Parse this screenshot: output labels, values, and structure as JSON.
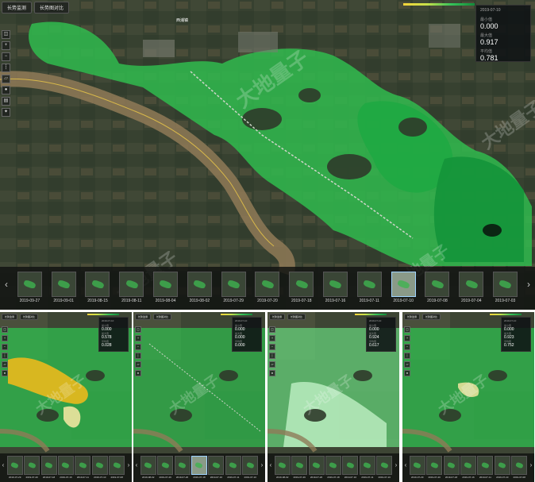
{
  "tabs": [
    "长势监测",
    "长势图对比"
  ],
  "toolbar_icons": [
    "layers-icon",
    "zoom-in-icon",
    "zoom-out-icon",
    "ruler-icon",
    "area-icon",
    "marker-icon",
    "print-icon",
    "compass-icon"
  ],
  "main": {
    "date": "2019-07-10",
    "stats": [
      {
        "label": "最小值",
        "value": "0.000"
      },
      {
        "label": "最大值",
        "value": "0.917"
      },
      {
        "label": "平均值",
        "value": "0.781"
      }
    ],
    "watermark": "大地量子",
    "place": "西浦镇",
    "filmstrip": [
      "2019-09-27",
      "2019-09-01",
      "2019-08-15",
      "2019-08-11",
      "2019-08-04",
      "2019-08-02",
      "2019-07-29",
      "2019-07-20",
      "2019-07-18",
      "2019-07-16",
      "2019-07-11",
      "2019-07-10",
      "2019-07-08",
      "2019-07-04",
      "2019-07-03"
    ],
    "active_index": 11
  },
  "small_panels": [
    {
      "date": "2019-07-10",
      "stats": [
        {
          "label": "最小值",
          "value": "0.000"
        },
        {
          "label": "最大值",
          "value": "0.578"
        },
        {
          "label": "平均值",
          "value": "0.028"
        }
      ],
      "thumbs": [
        "2019-07-29",
        "2019-07-20",
        "2019-07-18",
        "2019-07-16",
        "2019-07-11",
        "2019-07-10",
        "2019-07-08"
      ]
    },
    {
      "date": "2019-07-10",
      "stats": [
        {
          "label": "最小值",
          "value": "0.000"
        },
        {
          "label": "最大值",
          "value": "0.000"
        },
        {
          "label": "平均值",
          "value": "0.000"
        }
      ],
      "thumbs": [
        "2019-08-02",
        "2019-07-29",
        "2019-07-20",
        "2019-07-18",
        "2019-07-16",
        "2019-07-11",
        "2019-07-10"
      ]
    },
    {
      "date": "2019-07-10",
      "stats": [
        {
          "label": "最小值",
          "value": "0.000"
        },
        {
          "label": "最大值",
          "value": "0.924"
        },
        {
          "label": "平均值",
          "value": "0.617"
        }
      ],
      "thumbs": [
        "2019-08-02",
        "2019-07-29",
        "2019-07-20",
        "2019-07-18",
        "2019-07-16",
        "2019-07-11",
        "2019-07-10"
      ]
    },
    {
      "date": "2019-07-10",
      "stats": [
        {
          "label": "最小值",
          "value": "0.000"
        },
        {
          "label": "最大值",
          "value": "0.923"
        },
        {
          "label": "平均值",
          "value": "0.752"
        }
      ],
      "thumbs": [
        "2019-07-29",
        "2019-07-20",
        "2019-07-18",
        "2019-07-16",
        "2019-07-11",
        "2019-07-10",
        "2019-07-08"
      ]
    }
  ]
}
